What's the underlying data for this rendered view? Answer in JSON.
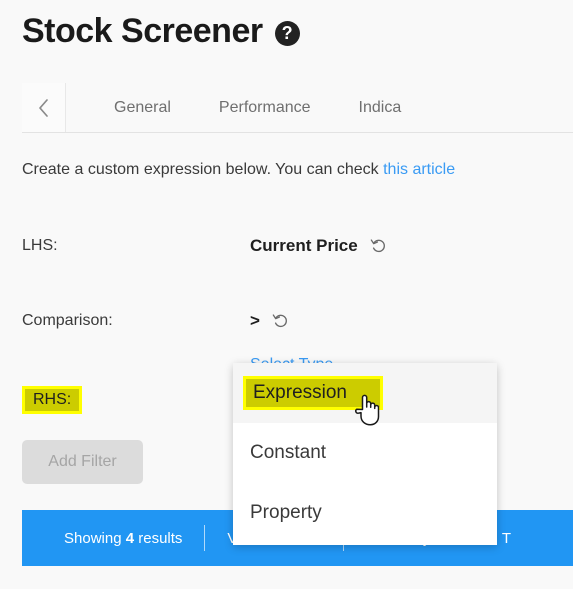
{
  "header": {
    "title": "Stock Screener",
    "help_icon": "question-mark-circle-icon",
    "help_glyph": "?"
  },
  "tabs": {
    "prev_icon": "chevron-left-icon",
    "items": [
      {
        "label": "General"
      },
      {
        "label": "Performance"
      },
      {
        "label": "Indica"
      }
    ]
  },
  "description": {
    "text_before": "Create a custom expression below. You can check ",
    "link_text": "this article",
    "text_after": " "
  },
  "form": {
    "lhs": {
      "label": "LHS:",
      "value": "Current Price",
      "reset_icon": "undo-arrow-icon"
    },
    "comparison": {
      "label": "Comparison:",
      "value": ">",
      "reset_icon": "undo-arrow-icon"
    },
    "rhs": {
      "label": "RHS:",
      "highlighted": true,
      "select_type_link": "Select Type"
    },
    "add_filter_label": "Add Filter",
    "add_filter_disabled": true
  },
  "dropdown": {
    "items": [
      {
        "label": "Expression",
        "active": true
      },
      {
        "label": "Constant",
        "active": false
      },
      {
        "label": "Property",
        "active": false
      }
    ]
  },
  "results_bar": {
    "showing_prefix": "Showing ",
    "showing_count": "4",
    "showing_suffix": " results",
    "view_label": "View: Charts",
    "view_caret": "▾",
    "sorted_label": "Sorted by: ChartMill T"
  },
  "cursor": {
    "icon": "hand-pointer-cursor"
  },
  "colors": {
    "page_background": "#f9f9f9",
    "accent_blue": "#2196f3",
    "link_blue": "#3a9bf4",
    "highlight_fill": "#cccc00",
    "highlight_border": "#ffff00",
    "disabled_button": "#dcdcdc"
  }
}
